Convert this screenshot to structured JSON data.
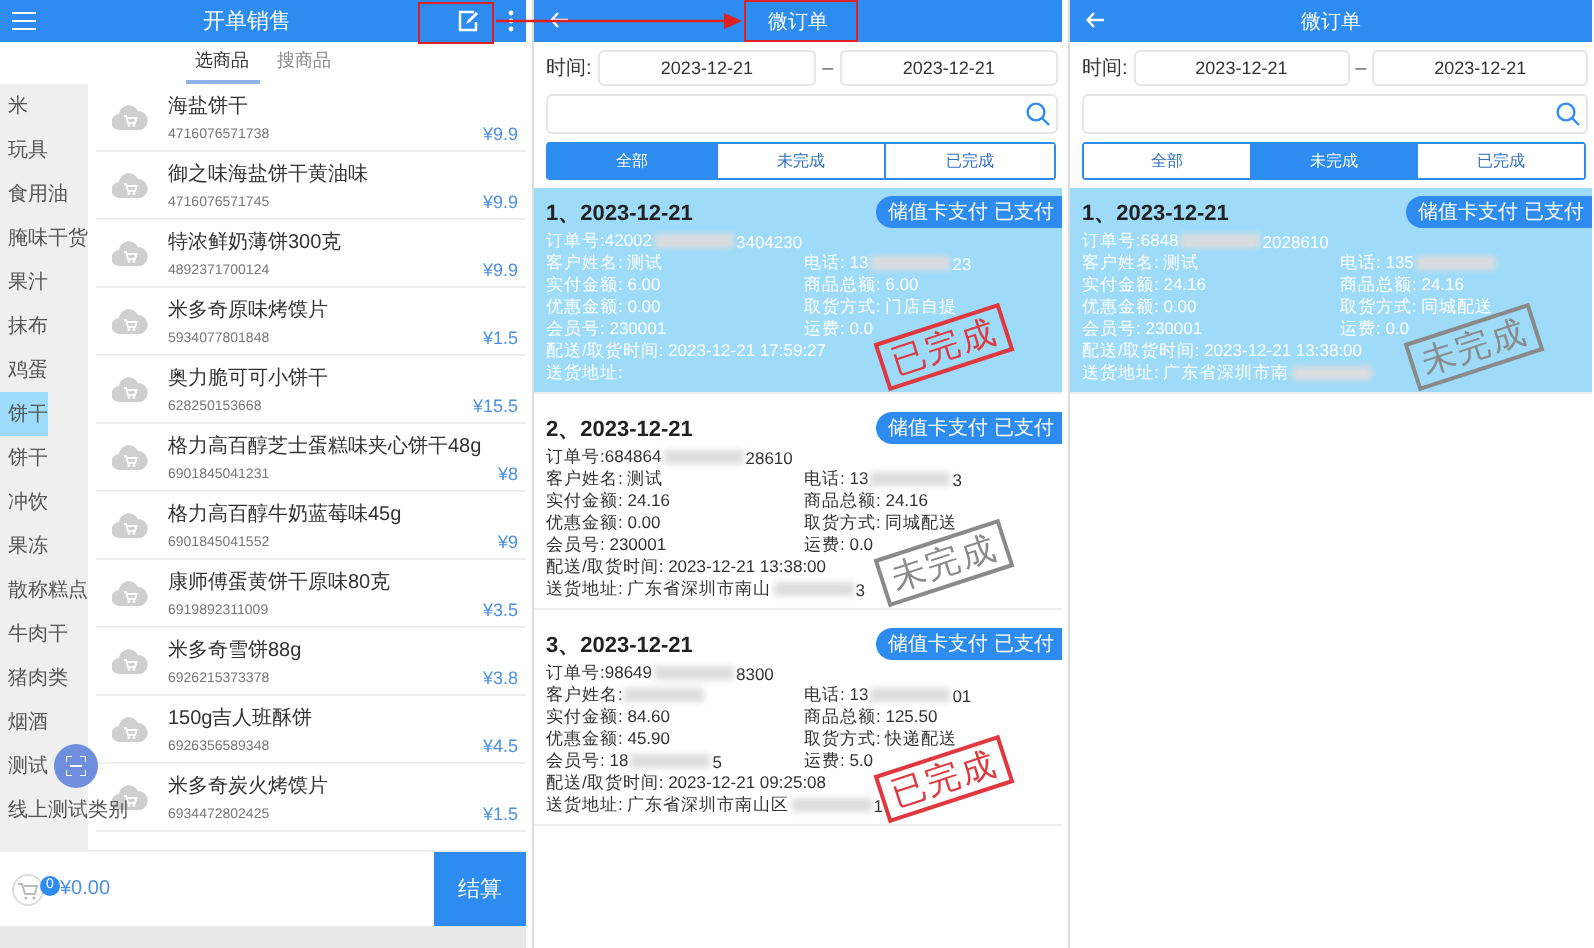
{
  "sale_screen": {
    "title": "开单销售",
    "tabs": [
      {
        "label": "选商品",
        "selected": true
      },
      {
        "label": "搜商品",
        "selected": false
      }
    ],
    "categories": [
      {
        "label": "米",
        "selected": false
      },
      {
        "label": "玩具",
        "selected": false
      },
      {
        "label": "食用油",
        "selected": false
      },
      {
        "label": "腌味干货",
        "selected": false
      },
      {
        "label": "果汁",
        "selected": false
      },
      {
        "label": "抹布",
        "selected": false
      },
      {
        "label": "鸡蛋",
        "selected": false
      },
      {
        "label": "饼干",
        "selected": true
      },
      {
        "label": "饼干",
        "selected": false
      },
      {
        "label": "冲饮",
        "selected": false
      },
      {
        "label": "果冻",
        "selected": false
      },
      {
        "label": "散称糕点",
        "selected": false
      },
      {
        "label": "牛肉干",
        "selected": false
      },
      {
        "label": "猪肉类",
        "selected": false
      },
      {
        "label": "烟酒",
        "selected": false
      },
      {
        "label": "测试",
        "selected": false
      },
      {
        "label": "线上测试类别",
        "selected": false
      }
    ],
    "products": [
      {
        "name": "海盐饼干",
        "barcode": "4716076571738",
        "price": "¥9.9"
      },
      {
        "name": "御之味海盐饼干黄油味",
        "barcode": "4716076571745",
        "price": "¥9.9"
      },
      {
        "name": "特浓鲜奶薄饼300克",
        "barcode": "4892371700124",
        "price": "¥9.9"
      },
      {
        "name": "米多奇原味烤馍片",
        "barcode": "5934077801848",
        "price": "¥1.5"
      },
      {
        "name": "奥力脆可可小饼干",
        "barcode": "628250153668",
        "price": "¥15.5"
      },
      {
        "name": "格力高百醇芝士蛋糕味夹心饼干48g",
        "barcode": "6901845041231",
        "price": "¥8"
      },
      {
        "name": "格力高百醇牛奶蓝莓味45g",
        "barcode": "6901845041552",
        "price": "¥9"
      },
      {
        "name": "康师傅蛋黄饼干原味80克",
        "barcode": "6919892311009",
        "price": "¥3.5"
      },
      {
        "name": "米多奇雪饼88g",
        "barcode": "6926215373378",
        "price": "¥3.8"
      },
      {
        "name": "150g吉人班酥饼",
        "barcode": "6926356589348",
        "price": "¥4.5"
      },
      {
        "name": "米多奇炭火烤馍片",
        "barcode": "6934472802425",
        "price": "¥1.5"
      }
    ],
    "cart": {
      "count": "0",
      "total": "¥0.00"
    },
    "checkout": "结算"
  },
  "order_screens": [
    {
      "title": "微订单",
      "time_label": "时间:",
      "date_from": "2023-12-21",
      "separator": "–",
      "date_to": "2023-12-21",
      "segments": [
        {
          "label": "全部",
          "selected": true
        },
        {
          "label": "未完成",
          "selected": false
        },
        {
          "label": "已完成",
          "selected": false
        }
      ],
      "orders": [
        {
          "title": "1、2023-12-21",
          "badge": "储值卡支付 已支付",
          "selected": true,
          "status": {
            "text": "已完成",
            "kind": "done"
          },
          "lines": [
            [
              {
                "text": "订单号:42002",
                "blurred": true,
                "tail": "3404230"
              }
            ],
            [
              {
                "text": "客户姓名: 测试"
              },
              {
                "text": "电话: 13",
                "blurred": true,
                "tail": "23"
              }
            ],
            [
              {
                "text": "实付金额: 6.00"
              },
              {
                "text": "商品总额: 6.00"
              }
            ],
            [
              {
                "text": "优惠金额: 0.00"
              },
              {
                "text": "取货方式: 门店自提"
              }
            ],
            [
              {
                "text": "会员号: 230001"
              },
              {
                "text": "运费: 0.0"
              }
            ],
            [
              {
                "text": "配送/取货时间: 2023-12-21 17:59:27"
              }
            ],
            [
              {
                "text": "送货地址:"
              }
            ]
          ]
        },
        {
          "title": "2、2023-12-21",
          "badge": "储值卡支付 已支付",
          "selected": false,
          "status": {
            "text": "未完成",
            "kind": "pending"
          },
          "lines": [
            [
              {
                "text": "订单号:684864",
                "blurred": true,
                "tail": "28610"
              }
            ],
            [
              {
                "text": "客户姓名: 测试"
              },
              {
                "text": "电话: 13",
                "blurred": true,
                "tail": "3"
              }
            ],
            [
              {
                "text": "实付金额: 24.16"
              },
              {
                "text": "商品总额: 24.16"
              }
            ],
            [
              {
                "text": "优惠金额: 0.00"
              },
              {
                "text": "取货方式: 同城配送"
              }
            ],
            [
              {
                "text": "会员号: 230001"
              },
              {
                "text": "运费: 0.0"
              }
            ],
            [
              {
                "text": "配送/取货时间: 2023-12-21 13:38:00"
              }
            ],
            [
              {
                "text": "送货地址: 广东省深圳市南山",
                "blurred": true,
                "tail": "3"
              }
            ]
          ]
        },
        {
          "title": "3、2023-12-21",
          "badge": "储值卡支付 已支付",
          "selected": false,
          "status": {
            "text": "已完成",
            "kind": "done"
          },
          "lines": [
            [
              {
                "text": "订单号:98649",
                "blurred": true,
                "tail": "8300"
              }
            ],
            [
              {
                "text": "客户姓名:",
                "blurred": true
              },
              {
                "text": "电话: 13",
                "blurred": true,
                "tail": "01"
              }
            ],
            [
              {
                "text": "实付金额: 84.60"
              },
              {
                "text": "商品总额: 125.50"
              }
            ],
            [
              {
                "text": "优惠金额: 45.90"
              },
              {
                "text": "取货方式: 快递配送"
              }
            ],
            [
              {
                "text": "会员号: 18",
                "blurred": true,
                "tail": "5"
              },
              {
                "text": "运费: 5.0"
              }
            ],
            [
              {
                "text": "配送/取货时间: 2023-12-21 09:25:08"
              }
            ],
            [
              {
                "text": "送货地址: 广东省深圳市南山区",
                "blurred": true,
                "tail": "1"
              }
            ]
          ]
        }
      ]
    },
    {
      "title": "微订单",
      "time_label": "时间:",
      "date_from": "2023-12-21",
      "separator": "–",
      "date_to": "2023-12-21",
      "segments": [
        {
          "label": "全部",
          "selected": false
        },
        {
          "label": "未完成",
          "selected": true
        },
        {
          "label": "已完成",
          "selected": false
        }
      ],
      "orders": [
        {
          "title": "1、2023-12-21",
          "badge": "储值卡支付 已支付",
          "selected": true,
          "status": {
            "text": "未完成",
            "kind": "pending"
          },
          "lines": [
            [
              {
                "text": "订单号:6848",
                "blurred": true,
                "tail": "2028610"
              }
            ],
            [
              {
                "text": "客户姓名: 测试"
              },
              {
                "text": "电话: 135",
                "blurred": true
              }
            ],
            [
              {
                "text": "实付金额: 24.16"
              },
              {
                "text": "商品总额: 24.16"
              }
            ],
            [
              {
                "text": "优惠金额: 0.00"
              },
              {
                "text": "取货方式: 同城配送"
              }
            ],
            [
              {
                "text": "会员号: 230001"
              },
              {
                "text": "运费: 0.0"
              }
            ],
            [
              {
                "text": "配送/取货时间: 2023-12-21 13:38:00"
              }
            ],
            [
              {
                "text": "送货地址: 广东省深圳市南",
                "blurred": true
              }
            ]
          ]
        }
      ]
    }
  ]
}
